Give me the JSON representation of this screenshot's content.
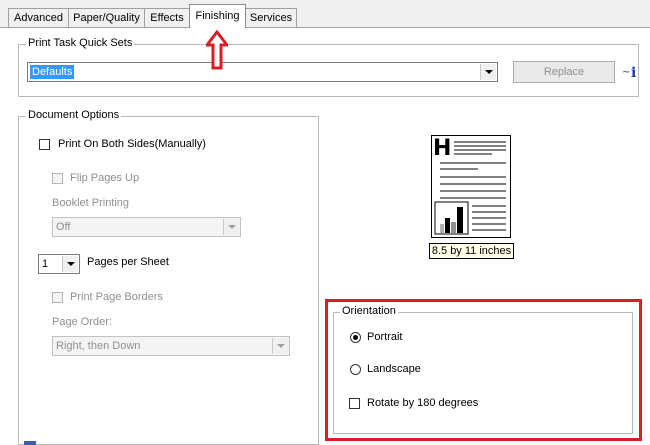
{
  "tabs": [
    {
      "label": "Advanced"
    },
    {
      "label": "Paper/Quality"
    },
    {
      "label": "Effects"
    },
    {
      "label": "Finishing"
    },
    {
      "label": "Services"
    }
  ],
  "active_tab": "Finishing",
  "quick_sets": {
    "legend": "Print Task Quick Sets",
    "value": "Defaults",
    "replace_label": "Replace"
  },
  "document_options": {
    "legend": "Document Options",
    "print_both_sides": "Print On Both Sides(Manually)",
    "flip_pages_up": "Flip Pages Up",
    "booklet_printing_label": "Booklet Printing",
    "booklet_value": "Off",
    "pages_per_sheet_value": "1",
    "pages_per_sheet_label": "Pages per Sheet",
    "print_page_borders": "Print Page Borders",
    "page_order_label": "Page Order:",
    "page_order_value": "Right, then Down"
  },
  "preview": {
    "heading_letter": "H",
    "size_label": "8.5 by 11 inches"
  },
  "orientation": {
    "legend": "Orientation",
    "portrait": "Portrait",
    "landscape": "Landscape",
    "rotate": "Rotate by 180 degrees",
    "selected": "Portrait"
  },
  "colors": {
    "highlight": "#d5202a",
    "arrow": "#d5202a",
    "selection": "#3399ff",
    "info_icon": "#1e3f9c"
  },
  "icons": [
    "up-arrow-annotation-icon",
    "info-icon",
    "chevron-down-icon"
  ]
}
